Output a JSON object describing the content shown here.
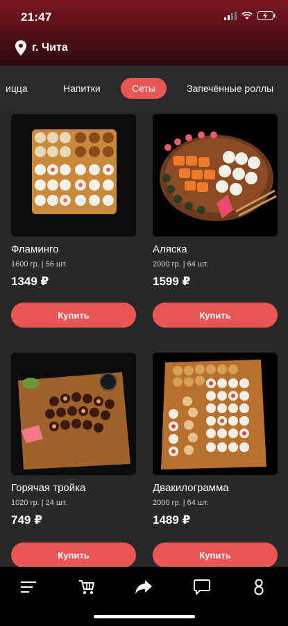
{
  "status_bar": {
    "time": "21:47"
  },
  "location": {
    "city": "г. Чита"
  },
  "categories": [
    {
      "label": "ицца",
      "active": false
    },
    {
      "label": "Напитки",
      "active": false
    },
    {
      "label": "Сеты",
      "active": true
    },
    {
      "label": "Запечённые роллы",
      "active": false
    }
  ],
  "products": [
    {
      "name": "Фламинго",
      "meta": "1600 гр. | 56 шт.",
      "price": "1349 ₽",
      "buy_label": "Купить"
    },
    {
      "name": "Аляска",
      "meta": "2000 гр. | 64 шт.",
      "price": "1599 ₽",
      "buy_label": "Купить"
    },
    {
      "name": "Горячая тройка",
      "meta": "1020 гр. | 24 шт.",
      "price": "749 ₽",
      "buy_label": "Купить"
    },
    {
      "name": "Двакилограмма",
      "meta": "2000 гр. | 64 шт.",
      "price": "1489 ₽",
      "buy_label": "Купить"
    }
  ],
  "bottom_nav": {
    "items": [
      {
        "icon": "menu-icon"
      },
      {
        "icon": "cart-icon"
      },
      {
        "icon": "share-icon"
      },
      {
        "icon": "chat-icon"
      },
      {
        "icon": "profile-icon"
      }
    ]
  },
  "colors": {
    "accent": "#e85656",
    "background": "#282828",
    "header": "#5a1018"
  }
}
